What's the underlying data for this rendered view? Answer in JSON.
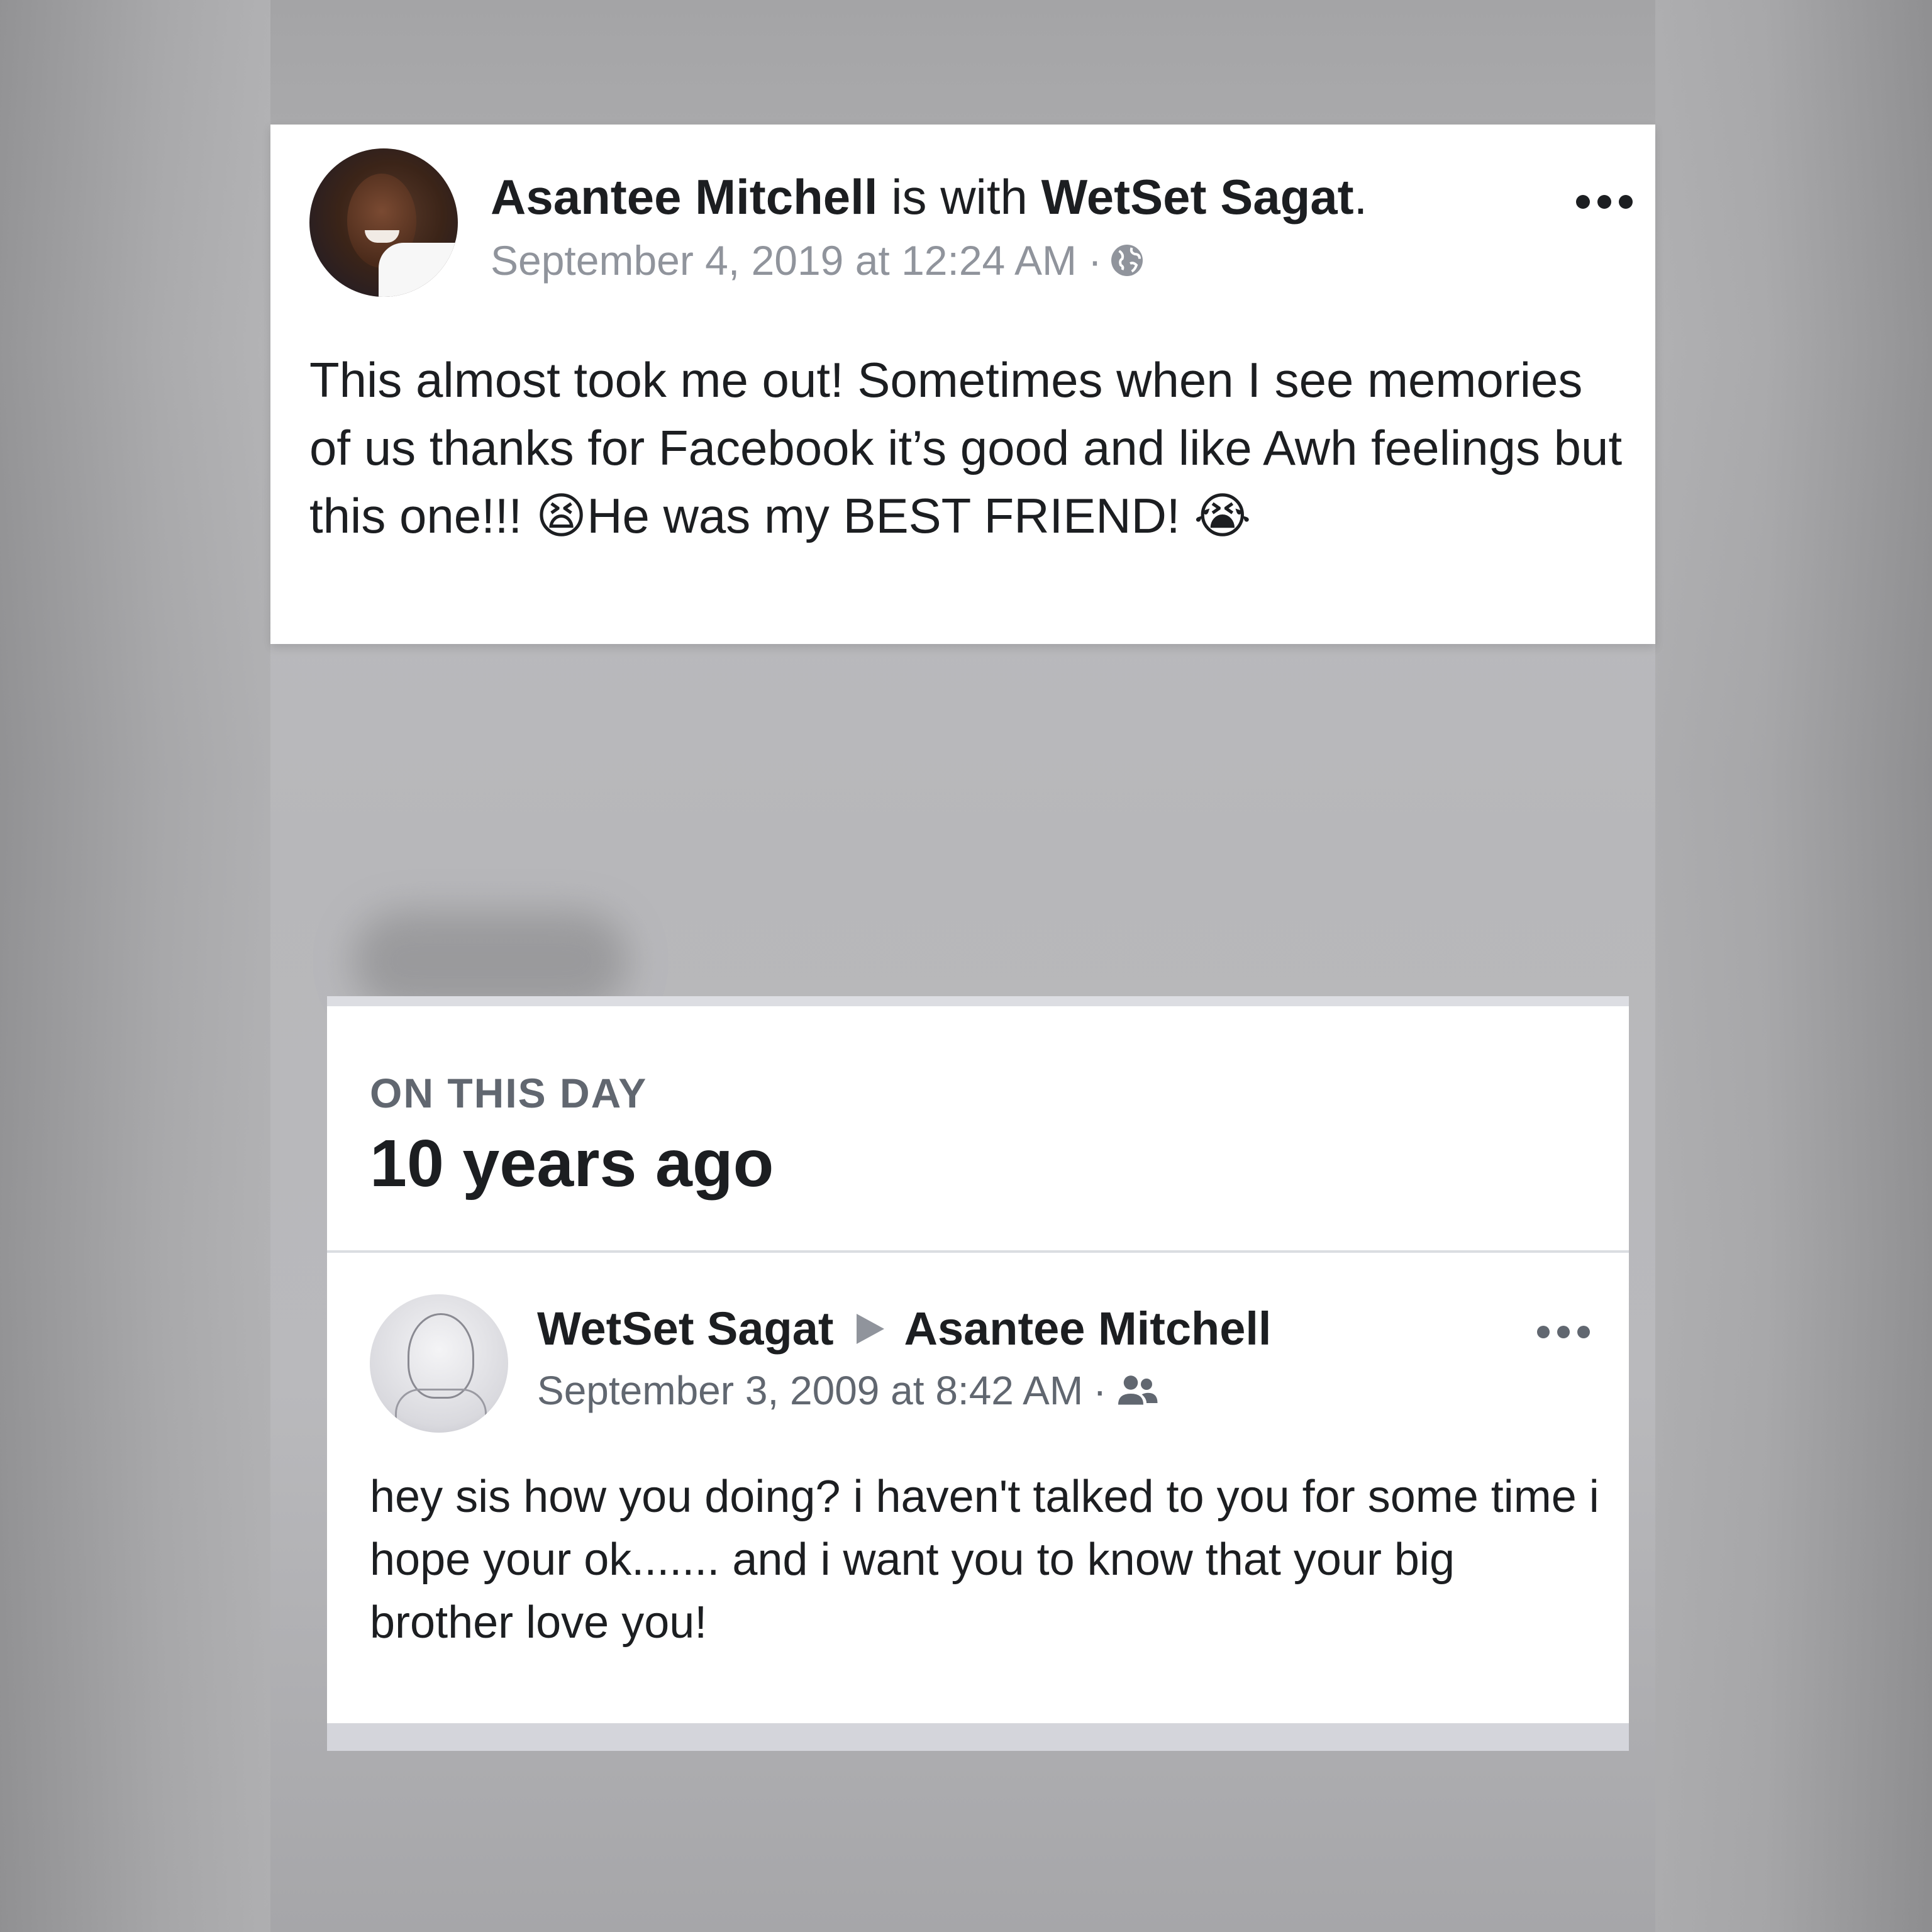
{
  "post": {
    "author": "Asantee Mitchell",
    "with_text": "is with",
    "tagged": "WetSet Sagat",
    "period": ".",
    "timestamp": "September 4, 2019 at 12:24 AM",
    "separator": "·",
    "privacy_icon": "globe-icon",
    "more_icon": "more-dots-icon",
    "text": "This almost took me out! Sometimes when I see memories of us thanks for Facebook it’s good and like Awh feelings but this one!!! 😫He was my BEST FRIEND! 😭"
  },
  "memory": {
    "label": "ON THIS DAY",
    "years": "10 years ago",
    "from": "WetSet Sagat",
    "to": "Asantee Mitchell",
    "arrow_icon": "arrow-right-icon",
    "timestamp": "September 3, 2009 at 8:42 AM",
    "separator": "·",
    "privacy_icon": "friends-icon",
    "more_icon": "more-dots-icon",
    "text": "hey sis how you doing? i haven't talked to you for some time i hope your ok....... and i want you to know that your big brother love you!"
  },
  "colors": {
    "text_primary": "#1c1e21",
    "text_secondary": "#90949c",
    "background_gray": "#b8b8bb"
  }
}
